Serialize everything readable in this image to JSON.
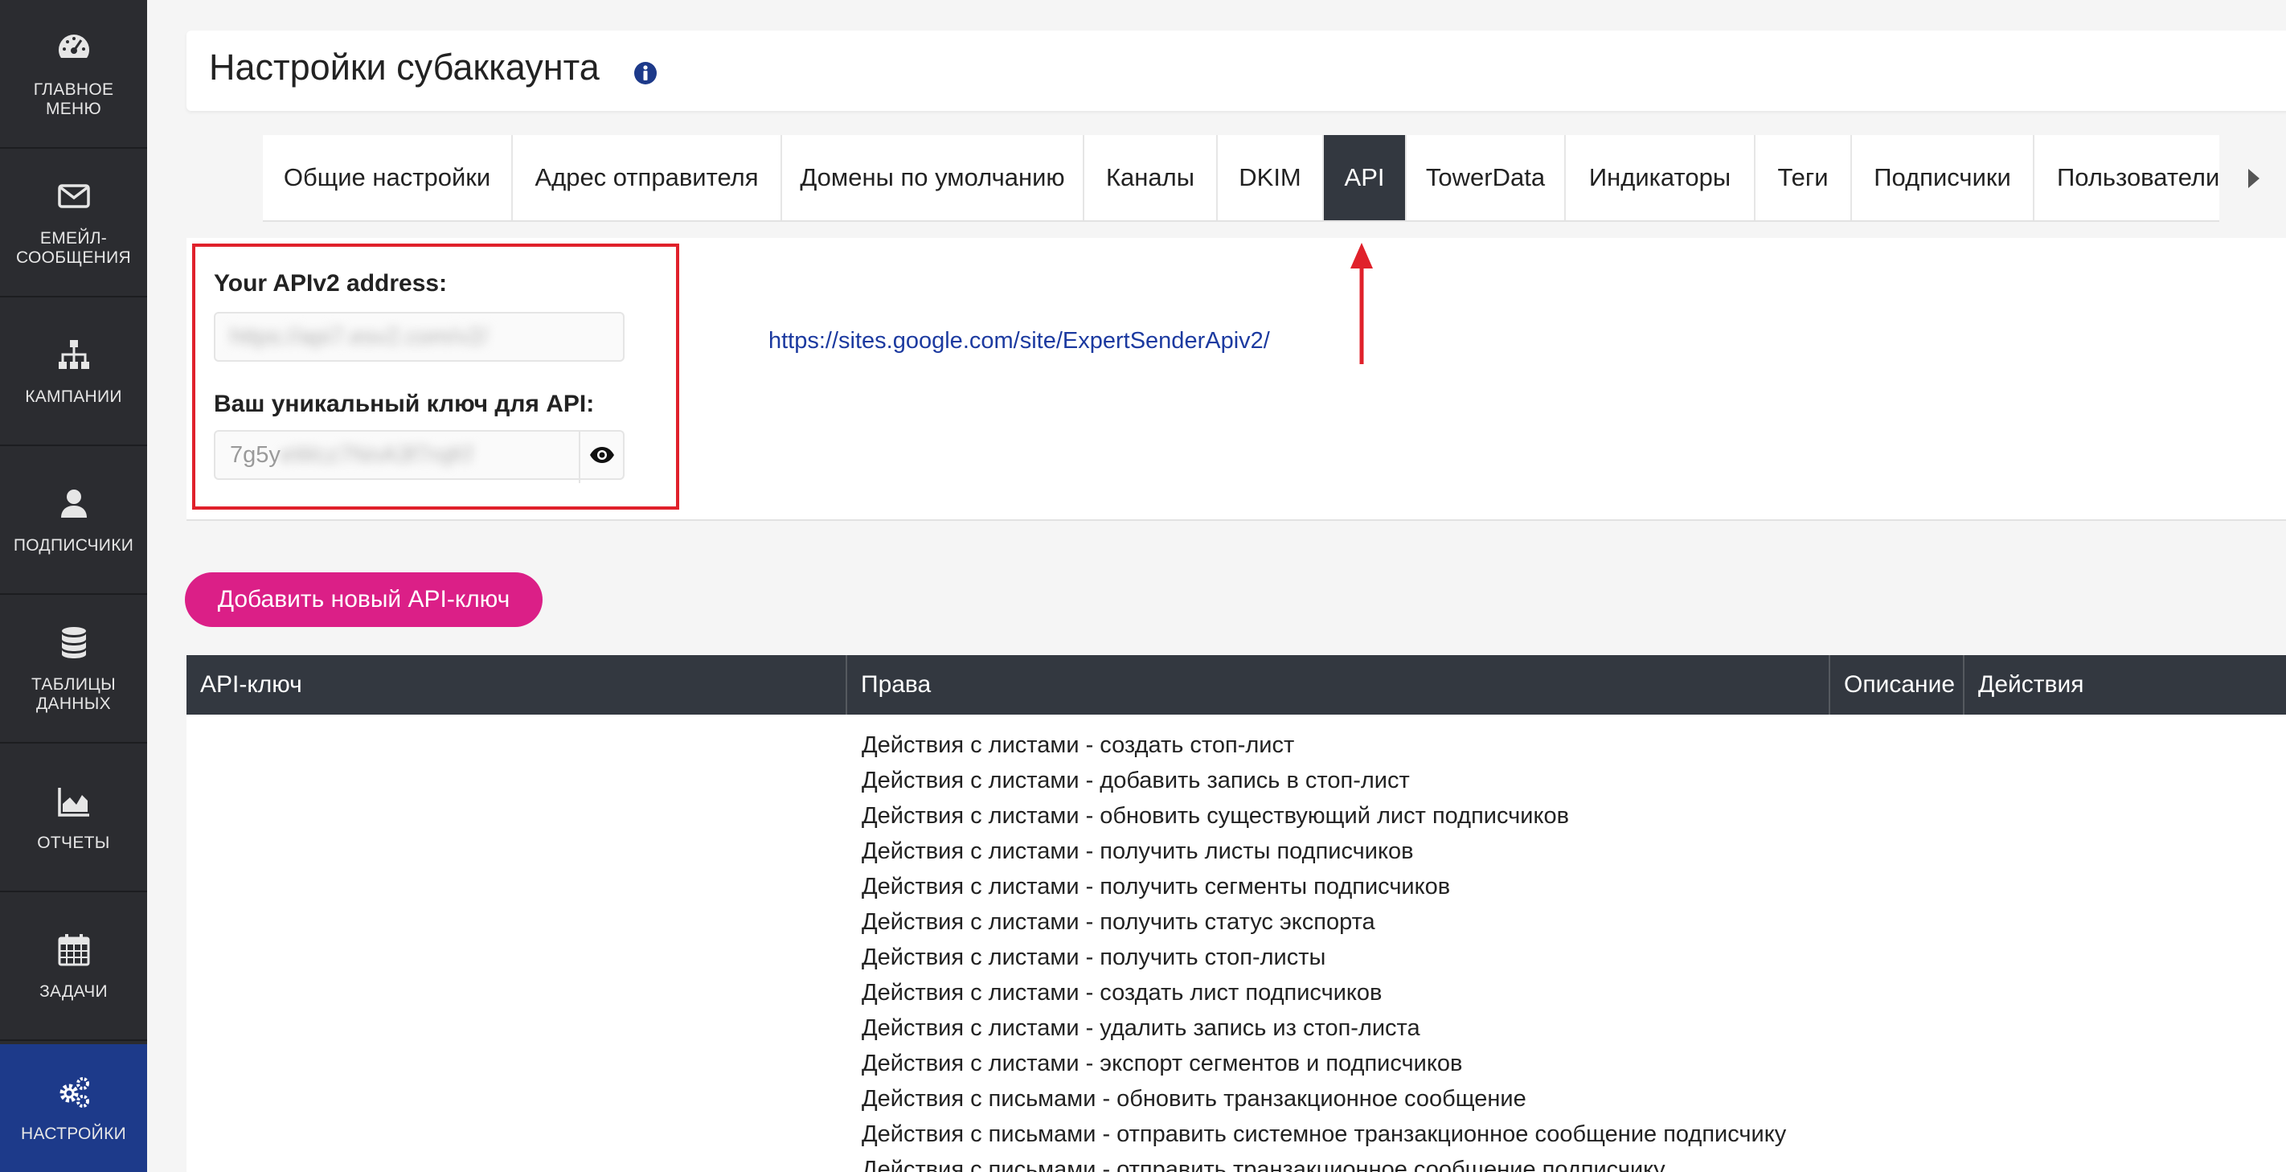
{
  "sidebar": {
    "items": [
      {
        "label": "ГЛАВНОЕ МЕНЮ",
        "icon": "dashboard-icon"
      },
      {
        "label": "ЕМЕЙЛ-СООБЩЕНИЯ",
        "icon": "envelope-icon"
      },
      {
        "label": "КАМПАНИИ",
        "icon": "sitemap-icon"
      },
      {
        "label": "ПОДПИСЧИКИ",
        "icon": "user-icon"
      },
      {
        "label": "ТАБЛИЦЫ ДАННЫХ",
        "icon": "database-icon"
      },
      {
        "label": "ОТЧЕТЫ",
        "icon": "area-chart-icon"
      },
      {
        "label": "ЗАДАЧИ",
        "icon": "calendar-icon"
      },
      {
        "label": "НАСТРОЙКИ",
        "icon": "gears-icon",
        "active": true
      }
    ],
    "background": "#2b2c30",
    "active_color": "#1d3a8a"
  },
  "header": {
    "title": "Настройки субаккаунта",
    "info_icon": "info-circle-icon"
  },
  "tabs": [
    {
      "label": "Общие настройки"
    },
    {
      "label": "Адрес отправителя"
    },
    {
      "label": "Домены по умолчанию"
    },
    {
      "label": "Каналы"
    },
    {
      "label": "DKIM"
    },
    {
      "label": "API",
      "active": true
    },
    {
      "label": "TowerData"
    },
    {
      "label": "Индикаторы"
    },
    {
      "label": "Теги"
    },
    {
      "label": "Подписчики"
    },
    {
      "label": "Пользователи"
    }
  ],
  "api": {
    "address_label": "Your APIv2 address:",
    "address_value": "https://api7.esv2.com/v2/",
    "key_label": "Ваш уникальный ключ для API:",
    "key_visible": "7g5y",
    "key_hidden": "eWcz7NnA3f7rqKf",
    "doc_link": "https://sites.google.com/site/ExpertSenderApiv2/",
    "highlight_color": "#e0212b"
  },
  "add_button": {
    "label": "Добавить новый API-ключ",
    "color": "#db1f87"
  },
  "table": {
    "headers": [
      "API-ключ",
      "Права",
      "Описание",
      "Действия"
    ],
    "rights": [
      "Действия с листами - создать стоп-лист",
      "Действия с листами - добавить запись в стоп-лист",
      "Действия с листами - обновить существующий лист подписчиков",
      "Действия с листами - получить листы подписчиков",
      "Действия с листами - получить сегменты подписчиков",
      "Действия с листами - получить статус экспорта",
      "Действия с листами - получить стоп-листы",
      "Действия с листами - создать лист подписчиков",
      "Действия с листами - удалить запись из стоп-листа",
      "Действия с листами - экспорт сегментов и подписчиков",
      "Действия с письмами - обновить транзакционное сообщение",
      "Действия с письмами - отправить системное транзакционное сообщение подписчику",
      "Действия с письмами - отправить транзакционное сообщение подписчику"
    ]
  }
}
